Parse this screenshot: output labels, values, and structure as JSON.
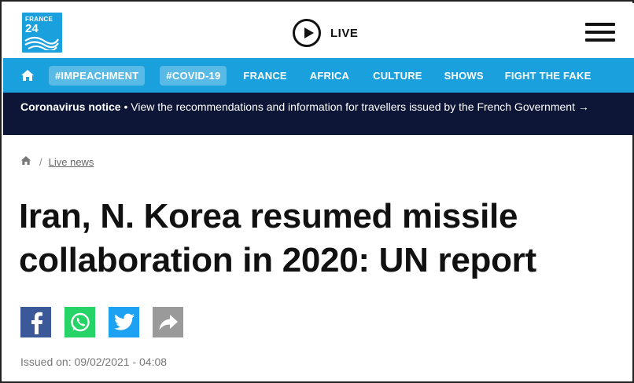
{
  "header": {
    "logo_brand": "FRANCE",
    "logo_number": "24",
    "live_label": "LIVE"
  },
  "nav": {
    "items": [
      {
        "label": "#IMPEACHMENT",
        "pill": true
      },
      {
        "label": "#COVID-19",
        "pill": true
      },
      {
        "label": "FRANCE",
        "pill": false
      },
      {
        "label": "AFRICA",
        "pill": false
      },
      {
        "label": "CULTURE",
        "pill": false
      },
      {
        "label": "SHOWS",
        "pill": false
      },
      {
        "label": "FIGHT THE FAKE",
        "pill": false
      }
    ]
  },
  "notice": {
    "title": "Coronavirus notice",
    "text": " • View the recommendations and information for travellers issued by the French Government →"
  },
  "breadcrumb": {
    "separator": "/",
    "link": "Live news"
  },
  "article": {
    "title_line1": "Iran, N. Korea resumed missile",
    "title_line2": "collaboration in 2020: UN report",
    "issued": "Issued on: 09/02/2021 - 04:08"
  },
  "colors": {
    "brand_blue": "#1aa0dc",
    "notice_bg": "#0d1636",
    "facebook": "#3b5998",
    "whatsapp": "#25d366",
    "twitter": "#1da1f2",
    "share": "#9a9a9a"
  },
  "icons": [
    "home-icon",
    "play-icon",
    "menu-icon",
    "facebook-icon",
    "whatsapp-icon",
    "twitter-icon",
    "share-icon"
  ]
}
